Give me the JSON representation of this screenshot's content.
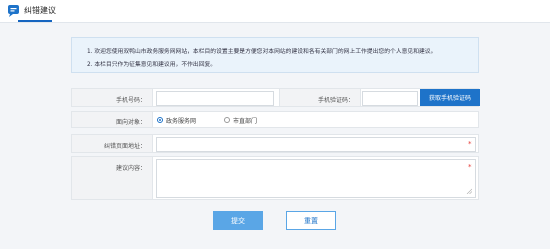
{
  "header": {
    "title": "纠错建议"
  },
  "notice": {
    "line1": "1. 欢迎您使用双鸭山市政务服务网网站，本栏目的设置主要是方便您对本网站的建设和各有关部门的网上工作提出您的个人意见和建议。",
    "line2": "2. 本栏目只作为征集意见和建议用，不作出回复。"
  },
  "form": {
    "phone_label": "手机号码：",
    "code_label": "手机验证码：",
    "get_code_button": "获取手机验证码",
    "target_label": "面向对象：",
    "target_options": [
      "政务服务网",
      "市直部门"
    ],
    "target_selected": "政务服务网",
    "url_label": "纠错页面地址：",
    "content_label": "建议内容：",
    "required_mark": "*"
  },
  "actions": {
    "submit": "提交",
    "reset": "重置"
  },
  "colors": {
    "accent": "#1e73c9",
    "submit_bg": "#5aa6e6",
    "required": "#e53935"
  }
}
